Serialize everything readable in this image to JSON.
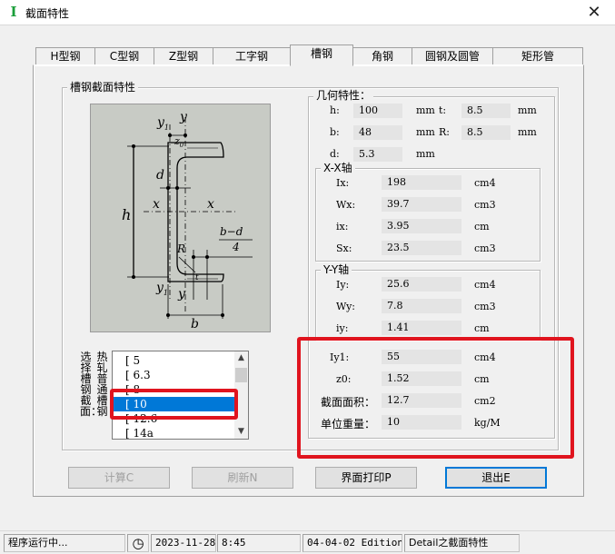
{
  "window": {
    "title": "截面特性",
    "close_glyph": "✕",
    "app_icon_glyph": "I"
  },
  "tabs": [
    {
      "label": "H型钢",
      "active": false
    },
    {
      "label": "C型钢",
      "active": false
    },
    {
      "label": "Z型钢",
      "active": false
    },
    {
      "label": "工字钢",
      "active": false
    },
    {
      "label": "槽钢",
      "active": true
    },
    {
      "label": "角钢",
      "active": false
    },
    {
      "label": "圆钢及圆管",
      "active": false
    },
    {
      "label": "矩形管",
      "active": false
    }
  ],
  "section_group": {
    "title": "槽钢截面特性"
  },
  "figure_labels": {
    "y1_top": "y",
    "y1_top_sub": "1",
    "y_top": "y",
    "z0": "z",
    "z0_sub": "0",
    "d": "d",
    "h": "h",
    "x_left": "x",
    "x_right": "x",
    "R": "R",
    "bd_num": "b−d",
    "bd_den": "4",
    "t": "t",
    "y1_bot": "y",
    "y1_bot_sub": "1",
    "y_bot": "y",
    "b": "b"
  },
  "selector": {
    "labels": [
      "选择槽钢截面：",
      "热轧普通槽钢"
    ],
    "items": [
      "[ 5",
      "[ 6.3",
      "[ 8",
      "[ 10",
      "[ 12.6",
      "[ 14a"
    ],
    "selected_index": 3,
    "scroll_up": "▲",
    "scroll_down": "▼"
  },
  "geometry": {
    "title": "几何特性：",
    "h": {
      "label": "h:",
      "value": "100",
      "unit": "mm"
    },
    "t": {
      "label": "t:",
      "value": "8.5",
      "unit": "mm"
    },
    "b": {
      "label": "b:",
      "value": "48",
      "unit": "mm"
    },
    "R": {
      "label": "R:",
      "value": "8.5",
      "unit": "mm"
    },
    "d": {
      "label": "d:",
      "value": "5.3",
      "unit": "mm"
    }
  },
  "xx_axis": {
    "title": "X-X轴",
    "rows": [
      {
        "label": "Ix:",
        "value": "198",
        "unit": "cm4"
      },
      {
        "label": "Wx:",
        "value": "39.7",
        "unit": "cm3"
      },
      {
        "label": "ix:",
        "value": "3.95",
        "unit": "cm"
      },
      {
        "label": "Sx:",
        "value": "23.5",
        "unit": "cm3"
      }
    ]
  },
  "yy_axis": {
    "title": "Y-Y轴",
    "rows": [
      {
        "label": "Iy:",
        "value": "25.6",
        "unit": "cm4"
      },
      {
        "label": "Wy:",
        "value": "7.8",
        "unit": "cm3"
      },
      {
        "label": "iy:",
        "value": "1.41",
        "unit": "cm"
      }
    ]
  },
  "extra": {
    "rows": [
      {
        "label": "Iy1:",
        "value": "55",
        "unit": "cm4"
      },
      {
        "label": "z0:",
        "value": "1.52",
        "unit": "cm"
      },
      {
        "label": "截面面积：",
        "value": "12.7",
        "unit": "cm2"
      },
      {
        "label": "单位重量：",
        "value": "10",
        "unit": "kg/M"
      }
    ]
  },
  "buttons": {
    "calc": "计算C",
    "refresh": "刷新N",
    "print": "界面打印P",
    "exit": "退出E"
  },
  "status": {
    "running": "程序运行中...",
    "clock_icon": "◷",
    "date": "2023-11-28",
    "time": "8:45",
    "edition": "04-04-02 Edition",
    "detail": "Detail之截面特性"
  },
  "colors": {
    "highlight_red": "#e0141e",
    "selection_blue": "#0078d7",
    "figure_bg": "#c8cbc5",
    "app_icon_green": "#1a9e3a"
  }
}
